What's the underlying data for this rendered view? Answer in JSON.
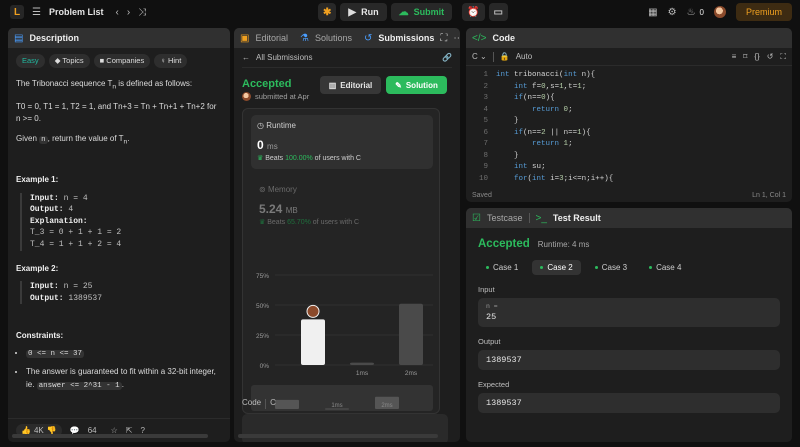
{
  "topbar": {
    "title": "Problem List",
    "run": "Run",
    "submit": "Submit",
    "streak": "0",
    "premium": "Premium"
  },
  "description": {
    "tab": "Description",
    "editorial_tab": "Editorial",
    "solutions_tab": "Solutions",
    "submissions_tab": "Submissions",
    "chips": {
      "easy": "Easy",
      "topics": "Topics",
      "companies": "Companies",
      "hint": "Hint"
    },
    "intro": "The Tribonacci sequence T",
    "intro_sub": "n",
    "intro_end": " is defined as follows:",
    "def1": "T",
    "def_text": "T0 = 0, T1 = 1, T2 = 1, and Tn+3 = Tn + Tn+1 + Tn+2 for n >= 0.",
    "given_a": "Given ",
    "given_n": "n",
    "given_b": ", return the value of T",
    "given_sub": "n",
    "ex1_title": "Example 1:",
    "ex1_input_k": "Input:",
    "ex1_input_v": " n = 4",
    "ex1_output_k": "Output:",
    "ex1_output_v": " 4",
    "ex1_expl_k": "Explanation:",
    "ex1_l1": "T_3 = 0 + 1 + 1 = 2",
    "ex1_l2": "T_4 = 1 + 1 + 2 = 4",
    "ex2_title": "Example 2:",
    "ex2_input_k": "Input:",
    "ex2_input_v": " n = 25",
    "ex2_output_k": "Output:",
    "ex2_output_v": " 1389537",
    "constraints_title": "Constraints:",
    "c1": "0 <= n <= 37",
    "c2a": "The answer is guaranteed to fit within a 32-bit integer, ie. ",
    "c2b": "answer <= 2^31 - 1",
    "c2c": ".",
    "likes": "4K",
    "comments": "64"
  },
  "submission": {
    "back": "All Submissions",
    "status": "Accepted",
    "submitted": "submitted at Apr",
    "editorial_btn": "Editorial",
    "solution_btn": "Solution",
    "runtime_label": "Runtime",
    "runtime_value": "0",
    "runtime_unit": "ms",
    "runtime_beats_a": "Beats ",
    "runtime_beats_pct": "100.00%",
    "runtime_beats_b": " of users with C",
    "memory_label": "Memory",
    "memory_value": "5.24",
    "memory_unit": "MB",
    "memory_beats_a": "Beats ",
    "memory_beats_pct": "65.70%",
    "memory_beats_b": " of users with C",
    "code_label": "Code",
    "code_lang": "C"
  },
  "chart_data": {
    "type": "bar",
    "categories": [
      "",
      "1ms",
      "2ms"
    ],
    "values": [
      38,
      2,
      51
    ],
    "ylabel": "",
    "ylim": [
      0,
      75
    ],
    "yticks": [
      "75%",
      "50%",
      "25%",
      "0%"
    ],
    "highlight_index": 0
  },
  "code": {
    "tab": "Code",
    "lang": "C",
    "auto": "Auto",
    "lines": [
      "int tribonacci(int n){",
      "    int f=0,s=1,t=1;",
      "    if(n==0){",
      "        return 0;",
      "    }",
      "    if(n==2 || n==1){",
      "        return 1;",
      "    }",
      "    int su;",
      "    for(int i=3;i<=n;i++){"
    ],
    "line_numbers": [
      "1",
      "2",
      "3",
      "4",
      "5",
      "6",
      "7",
      "8",
      "9",
      "10"
    ],
    "saved": "Saved",
    "cursor": "Ln 1, Col 1"
  },
  "test": {
    "testcase_tab": "Testcase",
    "result_tab": "Test Result",
    "status": "Accepted",
    "runtime": "Runtime: 4 ms",
    "cases": [
      "Case 1",
      "Case 2",
      "Case 3",
      "Case 4"
    ],
    "input_label": "Input",
    "input_var": "n =",
    "input_value": "25",
    "output_label": "Output",
    "output_value": "1389537",
    "expected_label": "Expected",
    "expected_value": "1389537"
  },
  "colors": {
    "accent_green": "#2cbb5d",
    "brand_orange": "#f0a020",
    "easy_teal": "#22b8a0"
  }
}
